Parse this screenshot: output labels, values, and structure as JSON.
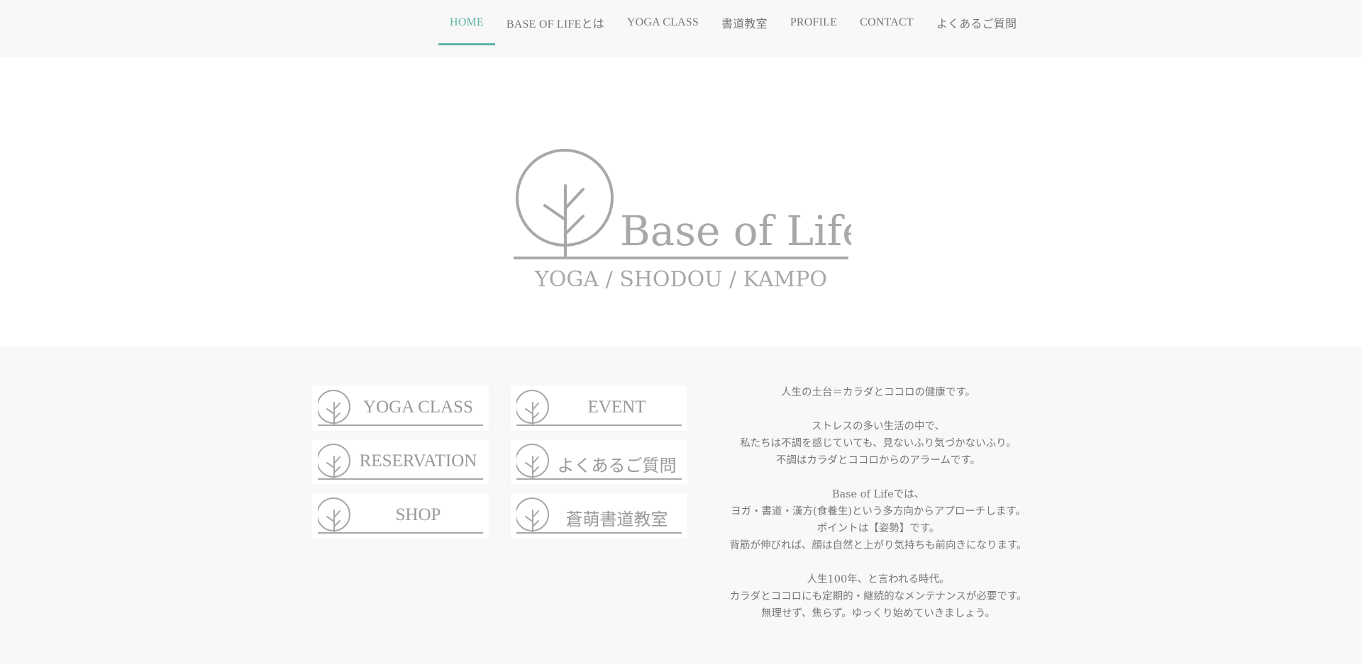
{
  "nav": {
    "items": [
      {
        "label": "HOME",
        "active": true
      },
      {
        "label": "BASE OF LIFEとは",
        "active": false
      },
      {
        "label": "YOGA CLASS",
        "active": false
      },
      {
        "label": "書道教室",
        "active": false
      },
      {
        "label": "PROFILE",
        "active": false
      },
      {
        "label": "CONTACT",
        "active": false
      },
      {
        "label": "よくあるご質問",
        "active": false
      }
    ],
    "accent_color": "#5bb3a0"
  },
  "hero": {
    "logo_title": "Base of Life",
    "logo_subtitle": "YOGA / SHODOU / KAMPO",
    "logo_icon": "tree-in-circle-icon"
  },
  "tiles": [
    {
      "label": "YOGA CLASS",
      "icon": "tree-icon"
    },
    {
      "label": "EVENT",
      "icon": "tree-icon"
    },
    {
      "label": "RESERVATION",
      "icon": "tree-icon"
    },
    {
      "label": "よくあるご質問",
      "icon": "tree-icon"
    },
    {
      "label": "SHOP",
      "icon": "tree-icon"
    },
    {
      "label": "蒼萌書道教室",
      "icon": "tree-icon"
    }
  ],
  "message": {
    "p1": [
      "人生の土台＝カラダとココロの健康です。"
    ],
    "p2": [
      "ストレスの多い生活の中で、",
      "私たちは不調を感じていても、見ないふり気づかないふり。",
      "不調はカラダとココロからのアラームです。"
    ],
    "p3": [
      "Base of Lifeでは、",
      "ヨガ・書道・漢方(食養生)という多方向からアプローチします。",
      "ポイントは【姿勢】です。",
      "背筋が伸びれば、顔は自然と上がり気持ちも前向きになります。"
    ],
    "p4": [
      "人生100年、と言われる時代。",
      "カラダとココロにも定期的・継続的なメンテナンスが必要です。",
      "無理せず、焦らず。ゆっくり始めていきましょう。"
    ]
  }
}
